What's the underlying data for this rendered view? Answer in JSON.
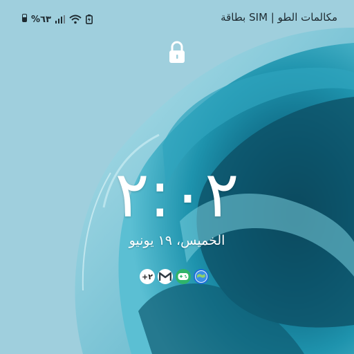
{
  "status_bar": {
    "battery_level": "%٦٣",
    "carrier": "مكالمات الطو | SIM بطاقة",
    "icons": [
      "battery-icon",
      "signal-icon",
      "wifi-icon",
      "battery-saver-icon"
    ]
  },
  "lock_screen": {
    "time": "٢:٠٢",
    "date": "الخميس، ١٩ يونيو",
    "more_notifications": "+٢",
    "notification_icons": [
      "globe-app-icon",
      "game-controller-icon",
      "gmail-icon"
    ]
  },
  "colors": {
    "sky": "#9fcfdd",
    "teal_dark": "#0b5e74",
    "teal_mid": "#1b8aa3",
    "teal_light": "#57bed2"
  }
}
